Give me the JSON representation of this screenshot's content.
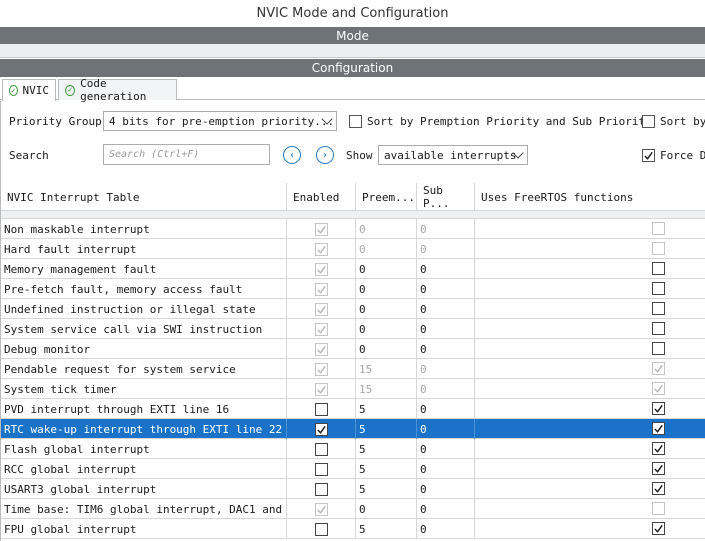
{
  "window": {
    "title": "NVIC Mode and Configuration"
  },
  "bands": {
    "mode": "Mode",
    "configuration": "Configuration"
  },
  "tabs": [
    {
      "label": "NVIC",
      "icon": "check-circle-icon"
    },
    {
      "label": "Code generation",
      "icon": "check-circle-icon"
    }
  ],
  "toolbar": {
    "priority_group_label": "Priority Group",
    "priority_group_value": "4 bits for pre-emption priority...",
    "sort_premption_label": "Sort by Premption Priority and Sub Priority",
    "sort_by_label": "Sort by",
    "search_label": "Search",
    "search_placeholder": "Search (Ctrl+F)",
    "show_label": "Show",
    "show_value": "available interrupts",
    "force_label": "Force DI"
  },
  "table": {
    "headers": [
      "NVIC Interrupt Table",
      "Enabled",
      "Preem...",
      "Sub P...",
      "Uses FreeRTOS functions"
    ],
    "rows": [
      {
        "name": "Non maskable interrupt",
        "enabled": true,
        "enabled_dim": true,
        "pre": "0",
        "sub": "0",
        "vals_dim": true,
        "freertos": false,
        "freertos_dim": true,
        "selected": false
      },
      {
        "name": "Hard fault interrupt",
        "enabled": true,
        "enabled_dim": true,
        "pre": "0",
        "sub": "0",
        "vals_dim": true,
        "freertos": false,
        "freertos_dim": true,
        "selected": false
      },
      {
        "name": "Memory management fault",
        "enabled": true,
        "enabled_dim": true,
        "pre": "0",
        "sub": "0",
        "vals_dim": false,
        "freertos": false,
        "freertos_dim": false,
        "selected": false
      },
      {
        "name": "Pre-fetch fault, memory access fault",
        "enabled": true,
        "enabled_dim": true,
        "pre": "0",
        "sub": "0",
        "vals_dim": false,
        "freertos": false,
        "freertos_dim": false,
        "selected": false
      },
      {
        "name": "Undefined instruction or illegal state",
        "enabled": true,
        "enabled_dim": true,
        "pre": "0",
        "sub": "0",
        "vals_dim": false,
        "freertos": false,
        "freertos_dim": false,
        "selected": false
      },
      {
        "name": "System service call via SWI instruction",
        "enabled": true,
        "enabled_dim": true,
        "pre": "0",
        "sub": "0",
        "vals_dim": false,
        "freertos": false,
        "freertos_dim": false,
        "selected": false
      },
      {
        "name": "Debug monitor",
        "enabled": true,
        "enabled_dim": true,
        "pre": "0",
        "sub": "0",
        "vals_dim": false,
        "freertos": false,
        "freertos_dim": false,
        "selected": false
      },
      {
        "name": "Pendable request for system service",
        "enabled": true,
        "enabled_dim": true,
        "pre": "15",
        "sub": "0",
        "vals_dim": true,
        "freertos": true,
        "freertos_dim": true,
        "selected": false
      },
      {
        "name": "System tick timer",
        "enabled": true,
        "enabled_dim": true,
        "pre": "15",
        "sub": "0",
        "vals_dim": true,
        "freertos": true,
        "freertos_dim": true,
        "selected": false
      },
      {
        "name": "PVD interrupt through EXTI line 16",
        "enabled": false,
        "enabled_dim": false,
        "pre": "5",
        "sub": "0",
        "vals_dim": false,
        "freertos": true,
        "freertos_dim": false,
        "selected": false
      },
      {
        "name": "RTC wake-up interrupt through EXTI line 22",
        "enabled": true,
        "enabled_dim": false,
        "pre": "5",
        "sub": "0",
        "vals_dim": false,
        "freertos": true,
        "freertos_dim": false,
        "selected": true
      },
      {
        "name": "Flash global interrupt",
        "enabled": false,
        "enabled_dim": false,
        "pre": "5",
        "sub": "0",
        "vals_dim": false,
        "freertos": true,
        "freertos_dim": false,
        "selected": false
      },
      {
        "name": "RCC global interrupt",
        "enabled": false,
        "enabled_dim": false,
        "pre": "5",
        "sub": "0",
        "vals_dim": false,
        "freertos": true,
        "freertos_dim": false,
        "selected": false
      },
      {
        "name": "USART3 global interrupt",
        "enabled": false,
        "enabled_dim": false,
        "pre": "5",
        "sub": "0",
        "vals_dim": false,
        "freertos": true,
        "freertos_dim": false,
        "selected": false
      },
      {
        "name": "Time base: TIM6 global interrupt, DAC1 and ...",
        "enabled": true,
        "enabled_dim": true,
        "pre": "0",
        "sub": "0",
        "vals_dim": false,
        "freertos": false,
        "freertos_dim": true,
        "selected": false
      },
      {
        "name": "FPU global interrupt",
        "enabled": false,
        "enabled_dim": false,
        "pre": "5",
        "sub": "0",
        "vals_dim": false,
        "freertos": true,
        "freertos_dim": false,
        "selected": false
      }
    ]
  },
  "colors": {
    "selection": "#1a73c8",
    "band": "#6e7378",
    "accent": "#2f7fc1"
  }
}
